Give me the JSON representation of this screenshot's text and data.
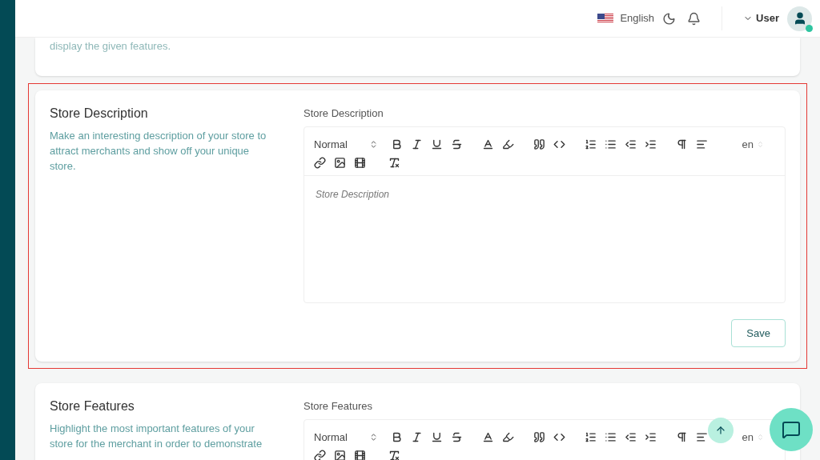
{
  "header": {
    "language": "English",
    "user": "User",
    "online": true
  },
  "sections": [
    {
      "kind": "partial",
      "description": "display the given features."
    },
    {
      "kind": "editor",
      "highlighted": true,
      "title": "Store Description",
      "description": "Make an interesting description of your store to attract merchants and show off your unique store.",
      "field_label": "Store Description",
      "format": "Normal",
      "language": "en",
      "placeholder": "Store Description",
      "button": "Save"
    },
    {
      "kind": "editor",
      "highlighted": false,
      "title": "Store Features",
      "description": "Highlight the most important features of your store for the merchant in order to demonstrate",
      "field_label": "Store Features",
      "format": "Normal",
      "language": "en"
    }
  ]
}
